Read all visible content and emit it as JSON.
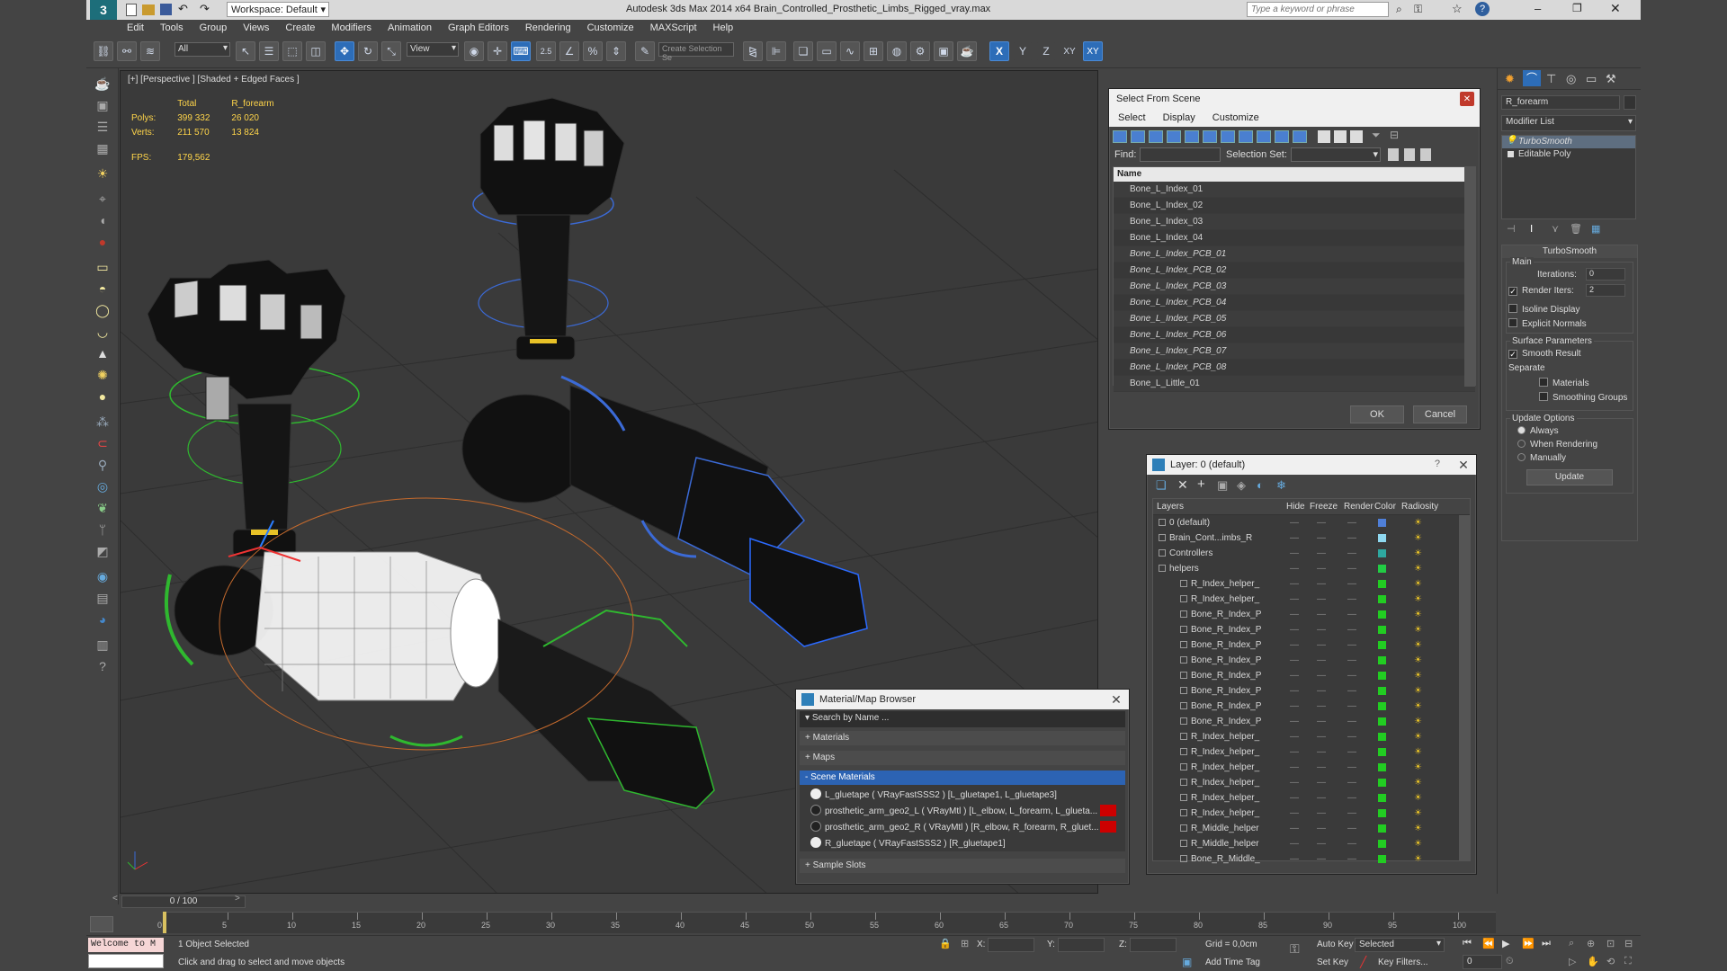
{
  "titlebar": {
    "workspace": "Workspace: Default",
    "title": "Autodesk 3ds Max  2014 x64     Brain_Controlled_Prosthetic_Limbs_Rigged_vray.max",
    "search_placeholder": "Type a keyword or phrase"
  },
  "menu": [
    "Edit",
    "Tools",
    "Group",
    "Views",
    "Create",
    "Modifiers",
    "Animation",
    "Graph Editors",
    "Rendering",
    "Customize",
    "MAXScript",
    "Help"
  ],
  "toolbar": {
    "filter": "All",
    "ref_coord": "View",
    "selection_set_placeholder": "Create Selection Se",
    "axis_x": "X",
    "axis_y": "Y",
    "axis_z": "Z",
    "axis_xy": "XY",
    "axis_xyz": "XY",
    "snap_val": "2.5",
    "pct_label": "%"
  },
  "viewport": {
    "label": "[+] [Perspective ] [Shaded + Edged Faces ]",
    "stats_total": "Total",
    "stats_obj": "R_forearm",
    "polys_label": "Polys:",
    "polys_total": "399 332",
    "polys_obj": "26 020",
    "verts_label": "Verts:",
    "verts_total": "211 570",
    "verts_obj": "13 824",
    "fps_label": "FPS:",
    "fps_val": "179,562"
  },
  "select_scene": {
    "title": "Select From Scene",
    "menu": [
      "Select",
      "Display",
      "Customize"
    ],
    "find_label": "Find:",
    "selset_label": "Selection Set:",
    "col_name": "Name",
    "items": [
      "Bone_L_Index_01",
      "Bone_L_Index_02",
      "Bone_L_Index_03",
      "Bone_L_Index_04",
      "Bone_L_Index_PCB_01",
      "Bone_L_Index_PCB_02",
      "Bone_L_Index_PCB_03",
      "Bone_L_Index_PCB_04",
      "Bone_L_Index_PCB_05",
      "Bone_L_Index_PCB_06",
      "Bone_L_Index_PCB_07",
      "Bone_L_Index_PCB_08",
      "Bone_L_Little_01"
    ],
    "ok": "OK",
    "cancel": "Cancel"
  },
  "layer_panel": {
    "title": "Layer: 0 (default)",
    "help": "?",
    "cols": [
      "Layers",
      "Hide",
      "Freeze",
      "Render",
      "Color",
      "Radiosity"
    ],
    "rows": [
      {
        "name": "0 (default)",
        "color": "#4f7fd8"
      },
      {
        "name": "Brain_Cont...imbs_R",
        "color": "#8fd8f0"
      },
      {
        "name": "Controllers",
        "color": "#2ea8a0"
      },
      {
        "name": "helpers",
        "color": "#22cc44"
      },
      {
        "name": "R_Index_helper_",
        "color": "#22cc22"
      },
      {
        "name": "R_Index_helper_",
        "color": "#22cc22"
      },
      {
        "name": "Bone_R_Index_P",
        "color": "#22cc22"
      },
      {
        "name": "Bone_R_Index_P",
        "color": "#22cc22"
      },
      {
        "name": "Bone_R_Index_P",
        "color": "#22cc22"
      },
      {
        "name": "Bone_R_Index_P",
        "color": "#22cc22"
      },
      {
        "name": "Bone_R_Index_P",
        "color": "#22cc22"
      },
      {
        "name": "Bone_R_Index_P",
        "color": "#22cc22"
      },
      {
        "name": "Bone_R_Index_P",
        "color": "#22cc22"
      },
      {
        "name": "Bone_R_Index_P",
        "color": "#22cc22"
      },
      {
        "name": "R_Index_helper_",
        "color": "#22cc22"
      },
      {
        "name": "R_Index_helper_",
        "color": "#22cc22"
      },
      {
        "name": "R_Index_helper_",
        "color": "#22cc22"
      },
      {
        "name": "R_Index_helper_",
        "color": "#22cc22"
      },
      {
        "name": "R_Index_helper_",
        "color": "#22cc22"
      },
      {
        "name": "R_Index_helper_",
        "color": "#22cc22"
      },
      {
        "name": "R_Middle_helper",
        "color": "#22cc22"
      },
      {
        "name": "R_Middle_helper",
        "color": "#22cc22"
      },
      {
        "name": "Bone_R_Middle_",
        "color": "#22cc22"
      }
    ]
  },
  "material_browser": {
    "title": "Material/Map Browser",
    "search": "Search by Name ...",
    "sec_materials": "+ Materials",
    "sec_maps": "+ Maps",
    "sec_scene": "- Scene Materials",
    "mat1": "L_gluetape  ( VRayFastSSS2 )  [L_gluetape1, L_gluetape3]",
    "mat2": "prosthetic_arm_geo2_L  ( VRayMtl )  [L_elbow, L_forearm, L_glueta...",
    "mat3": "prosthetic_arm_geo2_R  ( VRayMtl )  [R_elbow, R_forearm, R_gluet...",
    "mat4": "R_gluetape  ( VRayFastSSS2 )  [R_gluetape1]",
    "sec_slots": "+ Sample Slots"
  },
  "command_panel": {
    "object_name": "R_forearm",
    "modifier_list": "Modifier List",
    "stack": [
      "TurboSmooth",
      "Editable Poly"
    ],
    "ts_title": "TurboSmooth",
    "main": "Main",
    "iterations_label": "Iterations:",
    "iterations": "0",
    "render_iters_label": "Render Iters:",
    "render_iters": "2",
    "isoline": "Isoline Display",
    "explicit": "Explicit Normals",
    "surface": "Surface Parameters",
    "smooth_result": "Smooth Result",
    "separate": "Separate",
    "materials": "Materials",
    "smoothing": "Smoothing Groups",
    "update_opts": "Update Options",
    "always": "Always",
    "when_rendering": "When Rendering",
    "manually": "Manually",
    "update": "Update"
  },
  "timeline": {
    "frame": "0 / 100",
    "ticks": [
      "0",
      "5",
      "10",
      "15",
      "20",
      "25",
      "30",
      "35",
      "40",
      "45",
      "50",
      "55",
      "60",
      "65",
      "70",
      "75",
      "80",
      "85",
      "90",
      "95",
      "100"
    ]
  },
  "status": {
    "maxscript": "Welcome to M",
    "selected": "1 Object Selected",
    "prompt": "Click and drag to select and move objects",
    "x_label": "X:",
    "y_label": "Y:",
    "z_label": "Z:",
    "grid": "Grid = 0,0cm",
    "add_time_tag": "Add Time Tag",
    "auto_key": "Auto Key",
    "selected_dd": "Selected",
    "set_key": "Set Key",
    "key_filters": "Key Filters...",
    "frame_field": "0"
  }
}
